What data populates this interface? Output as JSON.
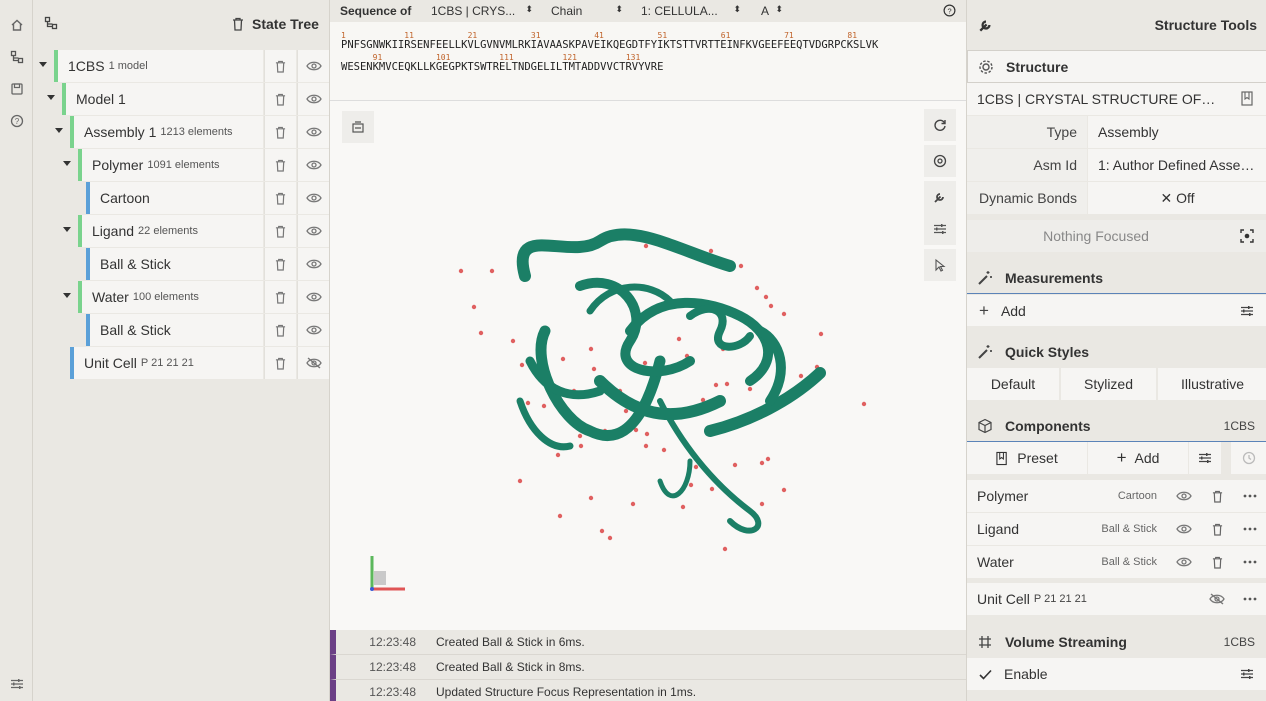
{
  "icons_left": [
    "home-icon",
    "tree-icon",
    "save-icon",
    "help-icon",
    "settings-icon"
  ],
  "tree": {
    "title": "State Tree",
    "rows": [
      {
        "label": "1CBS",
        "sub": "1 model"
      },
      {
        "label": "Model 1",
        "sub": ""
      },
      {
        "label": "Assembly 1",
        "sub": "1213 elements"
      },
      {
        "label": "Polymer",
        "sub": "1091 elements"
      },
      {
        "label": "Cartoon",
        "sub": ""
      },
      {
        "label": "Ligand",
        "sub": "22 elements"
      },
      {
        "label": "Ball & Stick",
        "sub": ""
      },
      {
        "label": "Water",
        "sub": "100 elements"
      },
      {
        "label": "Ball & Stick",
        "sub": ""
      },
      {
        "label": "Unit Cell",
        "sub": "P 21 21 21"
      }
    ]
  },
  "sequence": {
    "label": "Sequence of",
    "structure": "1CBS | CRYS...",
    "mode": "Chain",
    "entity": "1: CELLULA...",
    "chain": "A",
    "line1": "PNFSGNWKIIRSENFEELLKVLGVNVMLRKIAVAASKPAVEIKQEGDTFYIKTSTTVRTTEINFKVGEEFEEQTVDGRPCKSLVK",
    "line2": "WESENKMVCEQKLLKGEGPKTSWTRELTNDGELILTMTADDVVCTRVYVRE",
    "nums1": [
      "1",
      "11",
      "21",
      "31",
      "41",
      "51",
      "61",
      "71",
      "81"
    ],
    "nums2": [
      "91",
      "101",
      "111",
      "121",
      "131"
    ]
  },
  "log": [
    {
      "time": "12:23:48",
      "msg": "Created Ball & Stick in 6ms."
    },
    {
      "time": "12:23:48",
      "msg": "Created Ball & Stick in 8ms."
    },
    {
      "time": "12:23:48",
      "msg": "Updated Structure Focus Representation in 1ms."
    }
  ],
  "right": {
    "title": "Structure Tools",
    "structure": {
      "heading": "Structure",
      "name": "1CBS | CRYSTAL STRUCTURE OF…",
      "type_key": "Type",
      "type_val": "Assembly",
      "asm_key": "Asm Id",
      "asm_val": "1: Author Defined Asse…",
      "bonds_key": "Dynamic Bonds",
      "bonds_val": "Off",
      "focus": "Nothing Focused"
    },
    "measurements": {
      "heading": "Measurements",
      "add": "Add"
    },
    "quick_styles": {
      "heading": "Quick Styles",
      "options": [
        "Default",
        "Stylized",
        "Illustrative"
      ]
    },
    "components": {
      "heading": "Components",
      "tag": "1CBS",
      "preset": "Preset",
      "add": "Add",
      "items": [
        {
          "name": "Polymer",
          "repr": "Cartoon"
        },
        {
          "name": "Ligand",
          "repr": "Ball & Stick"
        },
        {
          "name": "Water",
          "repr": "Ball & Stick"
        }
      ],
      "unitcell": "Unit Cell",
      "unitcell_sub": "P 21 21 21"
    },
    "volume": {
      "heading": "Volume Streaming",
      "tag": "1CBS",
      "enable": "Enable"
    }
  },
  "colors": {
    "accent_green": "#7ad38d",
    "accent_blue": "#5ba0d8",
    "protein": "#1b7f66",
    "water": "#e06060",
    "log_bar": "#6b3f86"
  }
}
